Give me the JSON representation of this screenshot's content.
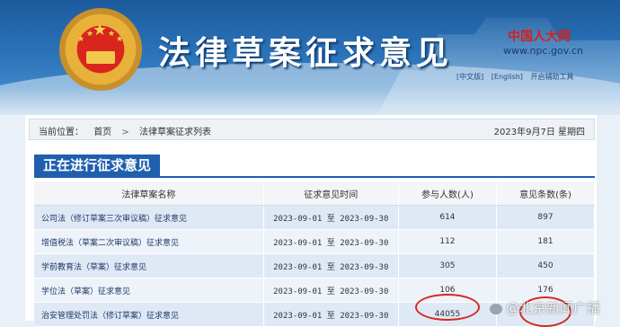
{
  "header": {
    "site_title": "法律草案征求意见",
    "npc_logo": "中国人大网",
    "npc_url": "www.npc.gov.cn",
    "links": [
      "[中文版]",
      "[English]",
      "开启辅助工具"
    ]
  },
  "breadcrumb": {
    "label": "当前位置：",
    "items": [
      "首页",
      "法律草案征求列表"
    ],
    "separator": ">",
    "date": "2023年9月7日 星期四"
  },
  "section": {
    "title": "正在进行征求意见"
  },
  "table": {
    "headers": [
      "法律草案名称",
      "征求意见时间",
      "参与人数(人)",
      "意见条数(条)"
    ],
    "rows": [
      {
        "name": "公司法（修订草案三次审议稿）征求意见",
        "start": "2023-09-01",
        "to": "至",
        "end": "2023-09-30",
        "participants": "614",
        "opinions": "897"
      },
      {
        "name": "增值税法（草案二次审议稿）征求意见",
        "start": "2023-09-01",
        "to": "至",
        "end": "2023-09-30",
        "participants": "112",
        "opinions": "181"
      },
      {
        "name": "学前教育法（草案）征求意见",
        "start": "2023-09-01",
        "to": "至",
        "end": "2023-09-30",
        "participants": "305",
        "opinions": "450"
      },
      {
        "name": "学位法（草案）征求意见",
        "start": "2023-09-01",
        "to": "至",
        "end": "2023-09-30",
        "participants": "106",
        "opinions": "176"
      },
      {
        "name": "治安管理处罚法（修订草案）征求意见",
        "start": "2023-09-01",
        "to": "至",
        "end": "2023-09-30",
        "participants": "44055",
        "opinions": ""
      }
    ]
  },
  "watermark": {
    "text": "@北京新闻广播"
  },
  "colors": {
    "accent": "#1f5fae",
    "highlight_circle": "#d22a1e",
    "row_odd": "#dfe9f6",
    "row_even": "#eef3fa"
  }
}
